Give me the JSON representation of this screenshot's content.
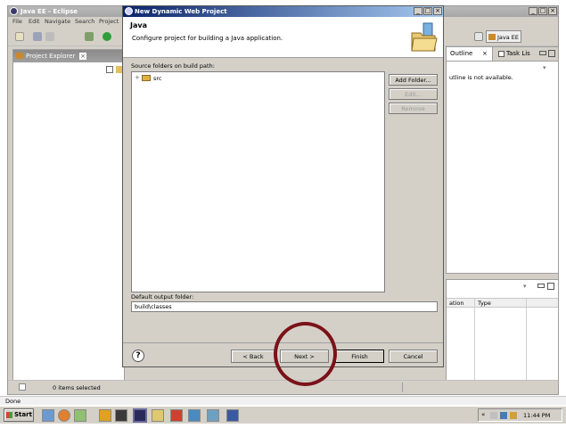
{
  "eclipse": {
    "title": "Java EE - Eclipse",
    "menu": [
      "File",
      "Edit",
      "Navigate",
      "Search",
      "Project"
    ],
    "perspective_label": "Java EE",
    "project_explorer_tab": "Project Explorer",
    "outline_tab": "Outline",
    "task_list_tab": "Task Lis",
    "outline_message": "utline is not available.",
    "props_columns": [
      "ation",
      "Type"
    ],
    "status_text": "0 items selected"
  },
  "dialog": {
    "title": "New Dynamic Web Project",
    "header_title": "Java",
    "header_desc": "Configure project for building a Java application.",
    "source_folders_label": "Source folders on build path:",
    "source_folders": [
      "src"
    ],
    "add_folder_button": "Add Folder...",
    "edit_button": "Edit...",
    "remove_button": "Remove",
    "output_folder_label": "Default output folder:",
    "output_folder_value": "build\\classes",
    "help_glyph": "?",
    "back_button": "< Back",
    "next_button": "Next >",
    "finish_button": "Finish",
    "cancel_button": "Cancel"
  },
  "browser_status": "Done",
  "taskbar": {
    "start_label": "Start",
    "clock": "11:44 PM"
  },
  "colors": {
    "dialog_title_gradient_start": "#0a246a",
    "annotation_circle": "#7a1218"
  }
}
